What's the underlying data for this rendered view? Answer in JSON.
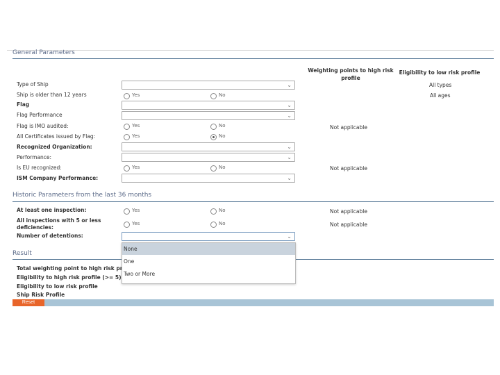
{
  "sections": {
    "general": "General Parameters",
    "historic": "Historic Parameters from the last 36 months",
    "result": "Result"
  },
  "columns": {
    "weighting": "Weighting points to high risk profile",
    "eligibility": "Eligibility to low risk profile"
  },
  "radio_labels": {
    "yes": "Yes",
    "no": "No"
  },
  "general_rows": {
    "type_of_ship": "Type of Ship",
    "ship_older": "Ship is older than 12 years",
    "flag": "Flag",
    "flag_performance": "Flag Performance",
    "flag_imo": "Flag is IMO audited:",
    "certificates_flag": "All Certificates issued by Flag:",
    "recognized_org": "Recognized Organization:",
    "performance": "Performance:",
    "eu_recognized": "Is EU recognized:",
    "ism_performance": "ISM Company Performance:"
  },
  "eligibility_values": {
    "all_types": "All types",
    "all_ages": "All ages"
  },
  "not_applicable": "Not applicable",
  "historic_rows": {
    "inspection": "At least one inspection:",
    "deficiencies": "All inspections with 5 or less deficiencies:",
    "detentions": "Number of detentions:"
  },
  "detention_options": [
    "None",
    "One",
    "Two or More"
  ],
  "result_rows": {
    "total": "Total weighting point to high risk profile",
    "high": "Eligibility to high risk profile (>= 5)",
    "low": "Eligibility to low risk profile",
    "ship_risk": "Ship Risk Profile"
  },
  "reset_label": "Reset",
  "colors": {
    "accent": "#e8652a",
    "section_line": "#4d7090",
    "footer_bar": "#a8c4d6",
    "highlight": "#c9d3dd"
  }
}
